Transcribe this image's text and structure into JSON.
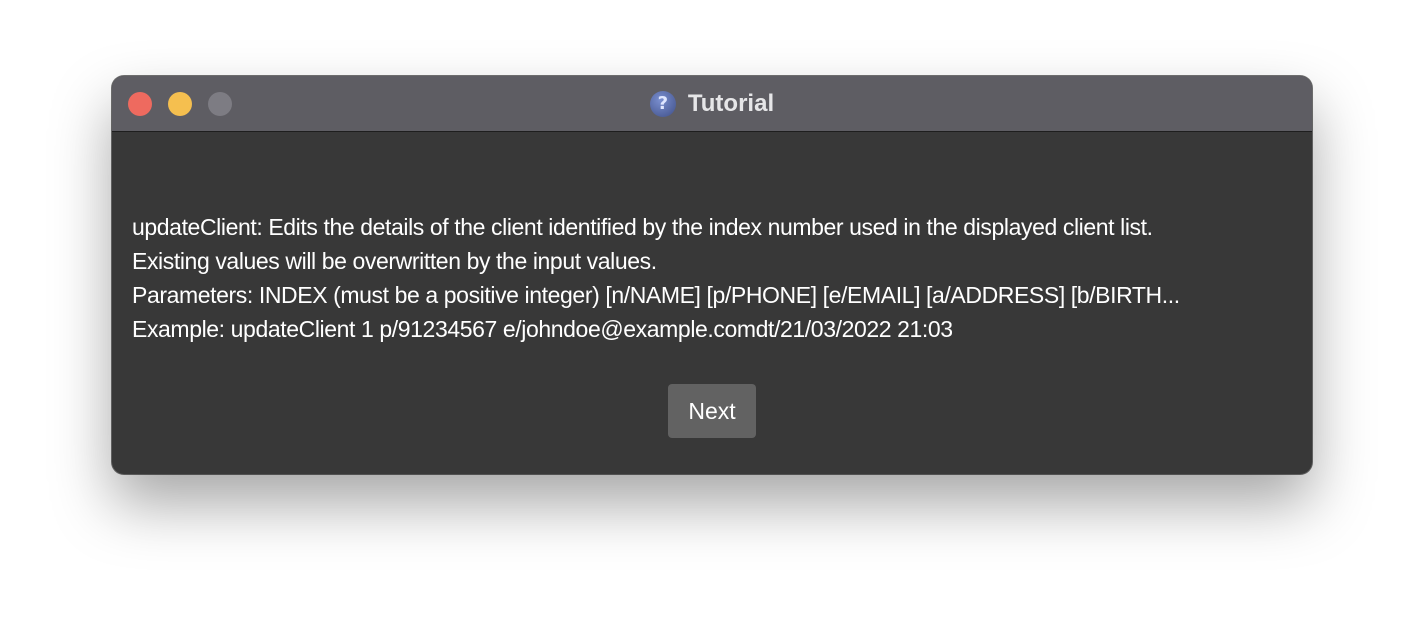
{
  "window": {
    "title": "Tutorial",
    "title_icon": "?",
    "title_icon_name": "help-icon"
  },
  "tutorial": {
    "lines": [
      "updateClient: Edits the details of the client identified by the index number used in the displayed client list.",
      "Existing values will be overwritten by the input values.",
      "Parameters: INDEX (must be a positive integer) [n/NAME] [p/PHONE] [e/EMAIL] [a/ADDRESS] [b/BIRTH...",
      "Example: updateClient 1 p/91234567 e/johndoe@example.comdt/21/03/2022 21:03"
    ]
  },
  "buttons": {
    "next_label": "Next"
  },
  "colors": {
    "close": "#ee6a5f",
    "minimize": "#f5bf4f",
    "zoom": "#7d7c83",
    "window_bg": "#383838",
    "titlebar_bg": "#5e5d63",
    "button_bg": "#626262"
  }
}
